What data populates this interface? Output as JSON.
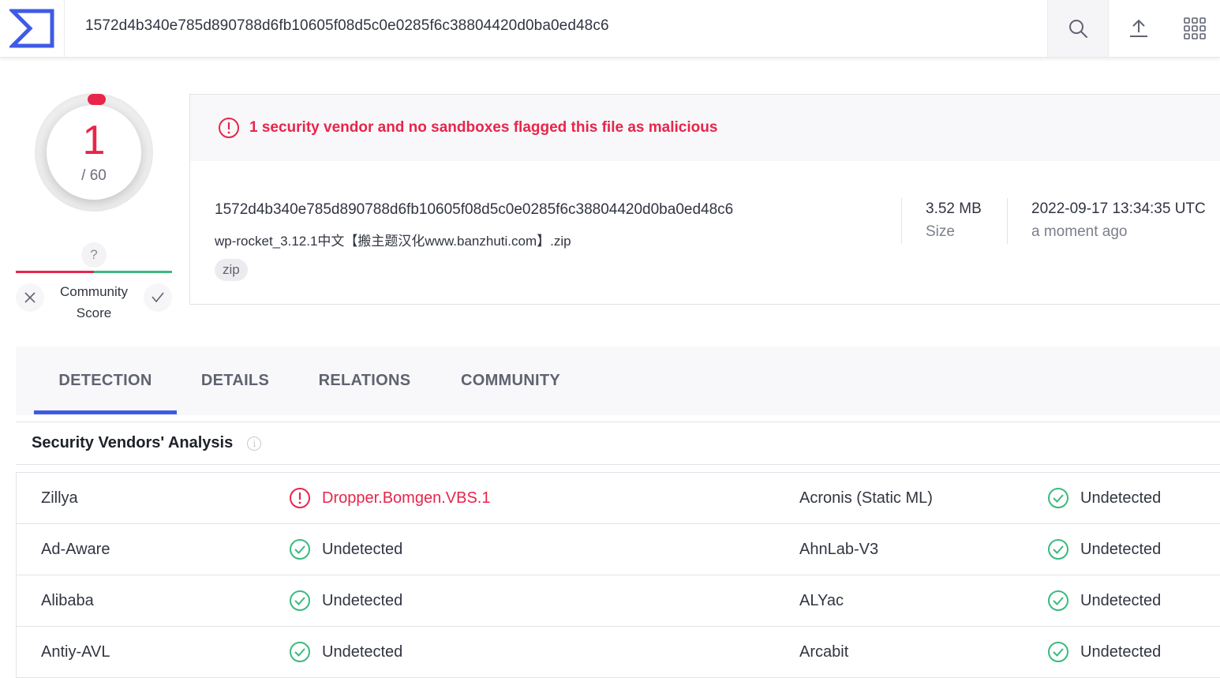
{
  "topbar": {
    "search_value": "1572d4b340e785d890788d6fb10605f08d5c0e0285f6c38804420d0ba0ed48c6",
    "icons": [
      "virustotal-logo",
      "search-icon",
      "upload-icon",
      "apps-grid-icon"
    ]
  },
  "score": {
    "detections": "1",
    "total": "/ 60",
    "community_unknown": "?",
    "community_label_line1": "Community",
    "community_label_line2": "Score"
  },
  "summary": {
    "alert": "1 security vendor and no sandboxes flagged this file as malicious",
    "hash": "1572d4b340e785d890788d6fb10605f08d5c0e0285f6c38804420d0ba0ed48c6",
    "filename": "wp-rocket_3.12.1中文【搬主题汉化www.banzhuti.com】.zip",
    "tag": "zip",
    "size_value": "3.52 MB",
    "size_label": "Size",
    "date_value": "2022-09-17 13:34:35 UTC",
    "date_label": "a moment ago"
  },
  "tabs": [
    "DETECTION",
    "DETAILS",
    "RELATIONS",
    "COMMUNITY"
  ],
  "active_tab": "DETECTION",
  "section": {
    "title": "Security Vendors' Analysis"
  },
  "results": [
    {
      "vendor1": "Zillya",
      "result1": "Dropper.Bomgen.VBS.1",
      "status1": "malicious",
      "vendor2": "Acronis (Static ML)",
      "result2": "Undetected",
      "status2": "clean"
    },
    {
      "vendor1": "Ad-Aware",
      "result1": "Undetected",
      "status1": "clean",
      "vendor2": "AhnLab-V3",
      "result2": "Undetected",
      "status2": "clean"
    },
    {
      "vendor1": "Alibaba",
      "result1": "Undetected",
      "status1": "clean",
      "vendor2": "ALYac",
      "result2": "Undetected",
      "status2": "clean"
    },
    {
      "vendor1": "Antiy-AVL",
      "result1": "Undetected",
      "status1": "clean",
      "vendor2": "Arcabit",
      "result2": "Undetected",
      "status2": "clean"
    }
  ],
  "colors": {
    "malicious": "#e8254b",
    "clean": "#3bba7f",
    "accent": "#3e5be6"
  }
}
